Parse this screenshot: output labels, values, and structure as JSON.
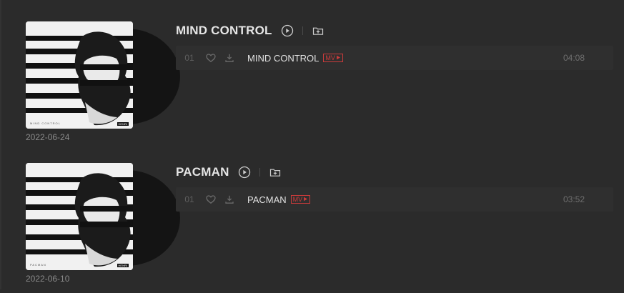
{
  "albums": [
    {
      "title": "MIND CONTROL",
      "release_date": "2022-06-24",
      "cover_caption": "MIND CONTROL",
      "cover_mark": "HENRI",
      "track": {
        "number": "01",
        "title": "MIND CONTROL",
        "badge": "MV",
        "duration": "04:08"
      }
    },
    {
      "title": "PACMAN",
      "release_date": "2022-06-10",
      "cover_caption": "PACMAN",
      "cover_mark": "HENRI",
      "track": {
        "number": "01",
        "title": "PACMAN",
        "badge": "MV",
        "duration": "03:52"
      }
    }
  ],
  "icons": {
    "play": "play-circle-icon",
    "add": "add-folder-icon",
    "like": "heart-icon",
    "download": "download-icon",
    "mv": "play-triangle-icon"
  },
  "colors": {
    "background": "#2b2b2b",
    "row": "#2f2f2f",
    "accent": "#cc3b3b",
    "text": "#e0e0e0",
    "muted": "#6f6f6f"
  }
}
